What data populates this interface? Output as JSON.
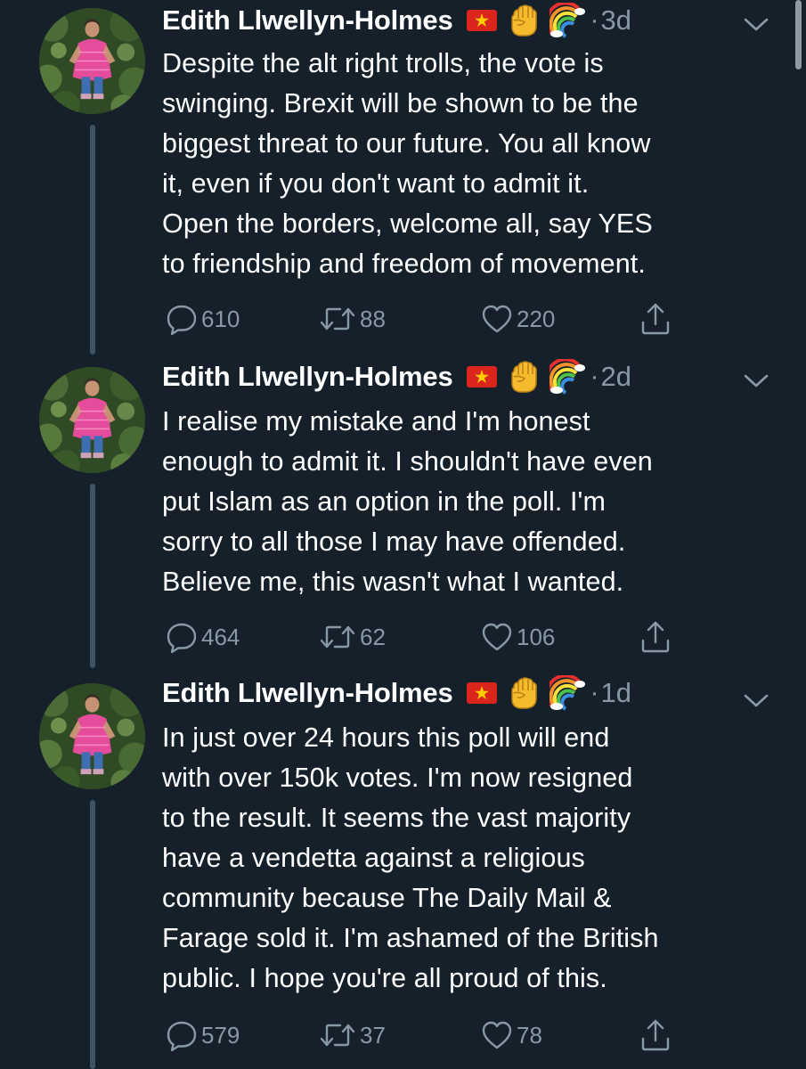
{
  "thread": {
    "tweets": [
      {
        "author": "Edith Llwellyn-Holmes",
        "badges": [
          "vietnam-flag-icon",
          "raised-fist-icon",
          "rainbow-icon"
        ],
        "separator": "·",
        "time": "3d",
        "lines": [
          "Despite the alt right trolls, the vote is",
          "swinging. Brexit will be shown to be the",
          "biggest threat to our future. You all know",
          "it, even if you don't want to admit it.",
          "Open the borders, welcome all, say YES",
          "to friendship and freedom of movement."
        ],
        "replies": "610",
        "retweets": "88",
        "likes": "220"
      },
      {
        "author": "Edith Llwellyn-Holmes",
        "badges": [
          "vietnam-flag-icon",
          "raised-fist-icon",
          "rainbow-icon"
        ],
        "separator": "·",
        "time": "2d",
        "lines": [
          "I realise my mistake and I'm honest",
          "enough to admit it. I shouldn't have even",
          "put Islam as an option in the poll. I'm",
          "sorry to all those I may have offended.",
          "Believe me, this wasn't what I wanted."
        ],
        "replies": "464",
        "retweets": "62",
        "likes": "106"
      },
      {
        "author": "Edith Llwellyn-Holmes",
        "badges": [
          "vietnam-flag-icon",
          "raised-fist-icon",
          "rainbow-icon"
        ],
        "separator": "·",
        "time": "1d",
        "lines": [
          "In just over 24 hours this poll will end",
          "with over 150k votes. I'm now resigned",
          "to the result. It seems the vast majority",
          "have a vendetta against a religious",
          "community because The Daily Mail &",
          "Farage sold it. I'm ashamed of the British",
          "public. I hope you're all proud of this."
        ],
        "replies": "579",
        "retweets": "37",
        "likes": "78"
      }
    ]
  },
  "colors": {
    "background": "#15202b",
    "text_primary": "#ffffff",
    "text_secondary": "#8899a6",
    "thread_line": "#3d5466"
  }
}
